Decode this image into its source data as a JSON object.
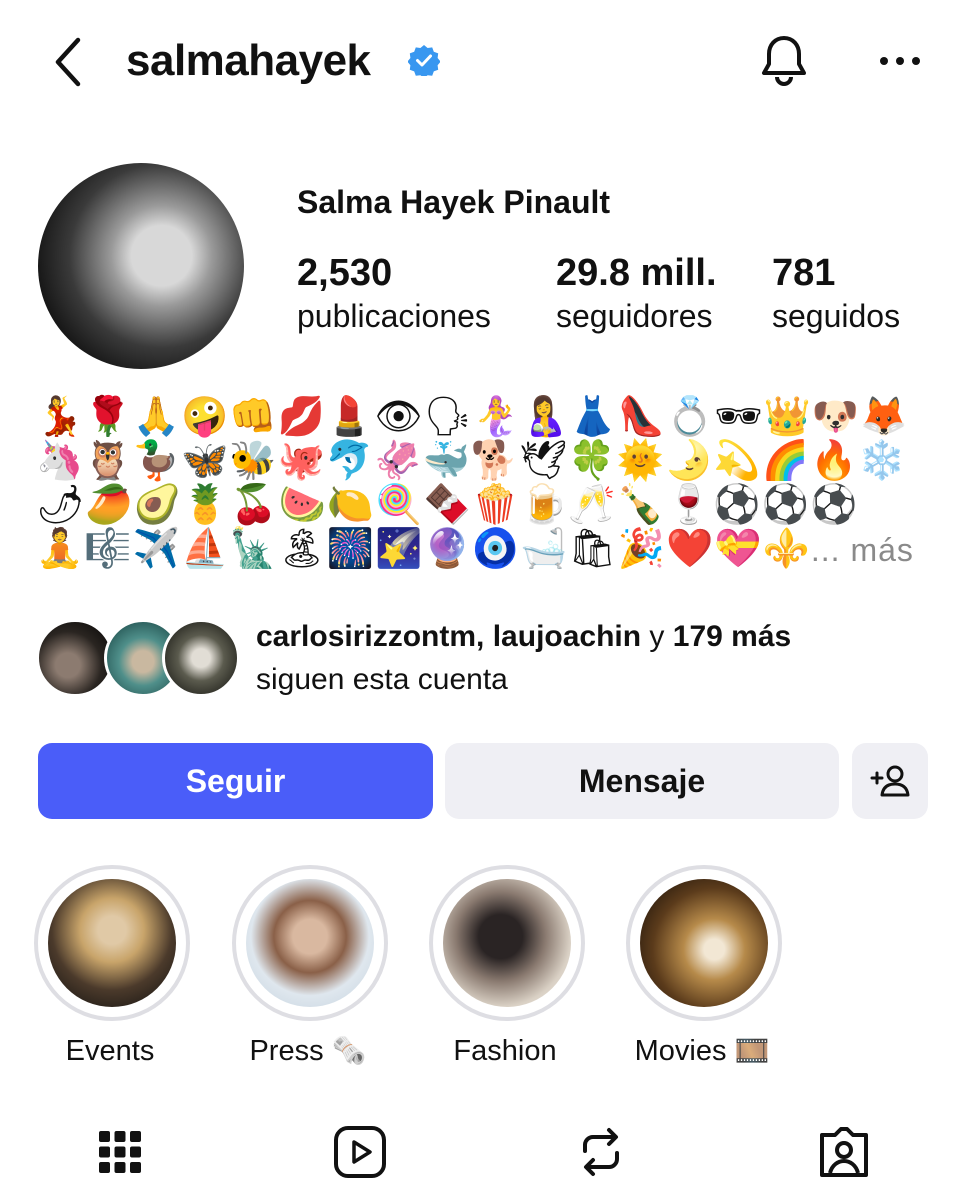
{
  "header": {
    "username": "salmahayek",
    "verified": true,
    "icons": [
      "back-chevron-icon",
      "verified-badge-icon",
      "bell-icon",
      "more-dots-icon"
    ]
  },
  "profile": {
    "full_name": "Salma Hayek Pinault",
    "stats": [
      {
        "value": "2,530",
        "label": "publicaciones"
      },
      {
        "value": "29.8 mill.",
        "label": "seguidores"
      },
      {
        "value": "781",
        "label": "seguidos"
      }
    ],
    "bio_rows": [
      "💃🌹🙏🤪👊💋💄👁🗣🧜‍♀️🤱👗👠💍🕶👑🐶🦊",
      "🦄🦉🦆🦋🐝🐙🐬🦑🐳🐕🕊🍀🌞🌛💫🌈🔥❄️",
      "🌶🥭🥑🍍🍒🍉🍋🍭🍫🍿🍺🥂🍾🍷⚽⚽⚽",
      "🧘🎼✈️⛵🗽🏝🎆🌠🔮🧿🛁🛍🎉❤️💝⚜️"
    ],
    "bio_more": "... más"
  },
  "followed_by": {
    "names": "carlosirizzontm, laujoachin",
    "connector": "y",
    "others": "179 más",
    "suffix": "siguen esta cuenta"
  },
  "actions": {
    "follow_label": "Seguir",
    "message_label": "Mensaje",
    "follow_color": "#4a5df9"
  },
  "highlights": [
    {
      "label": "Events",
      "emoji": ""
    },
    {
      "label": "Press",
      "emoji": "🗞️"
    },
    {
      "label": "Fashion",
      "emoji": ""
    },
    {
      "label": "Movies",
      "emoji": "🎞️"
    }
  ],
  "tabs": [
    "grid-icon",
    "reels-icon",
    "reposts-icon",
    "tagged-icon"
  ]
}
